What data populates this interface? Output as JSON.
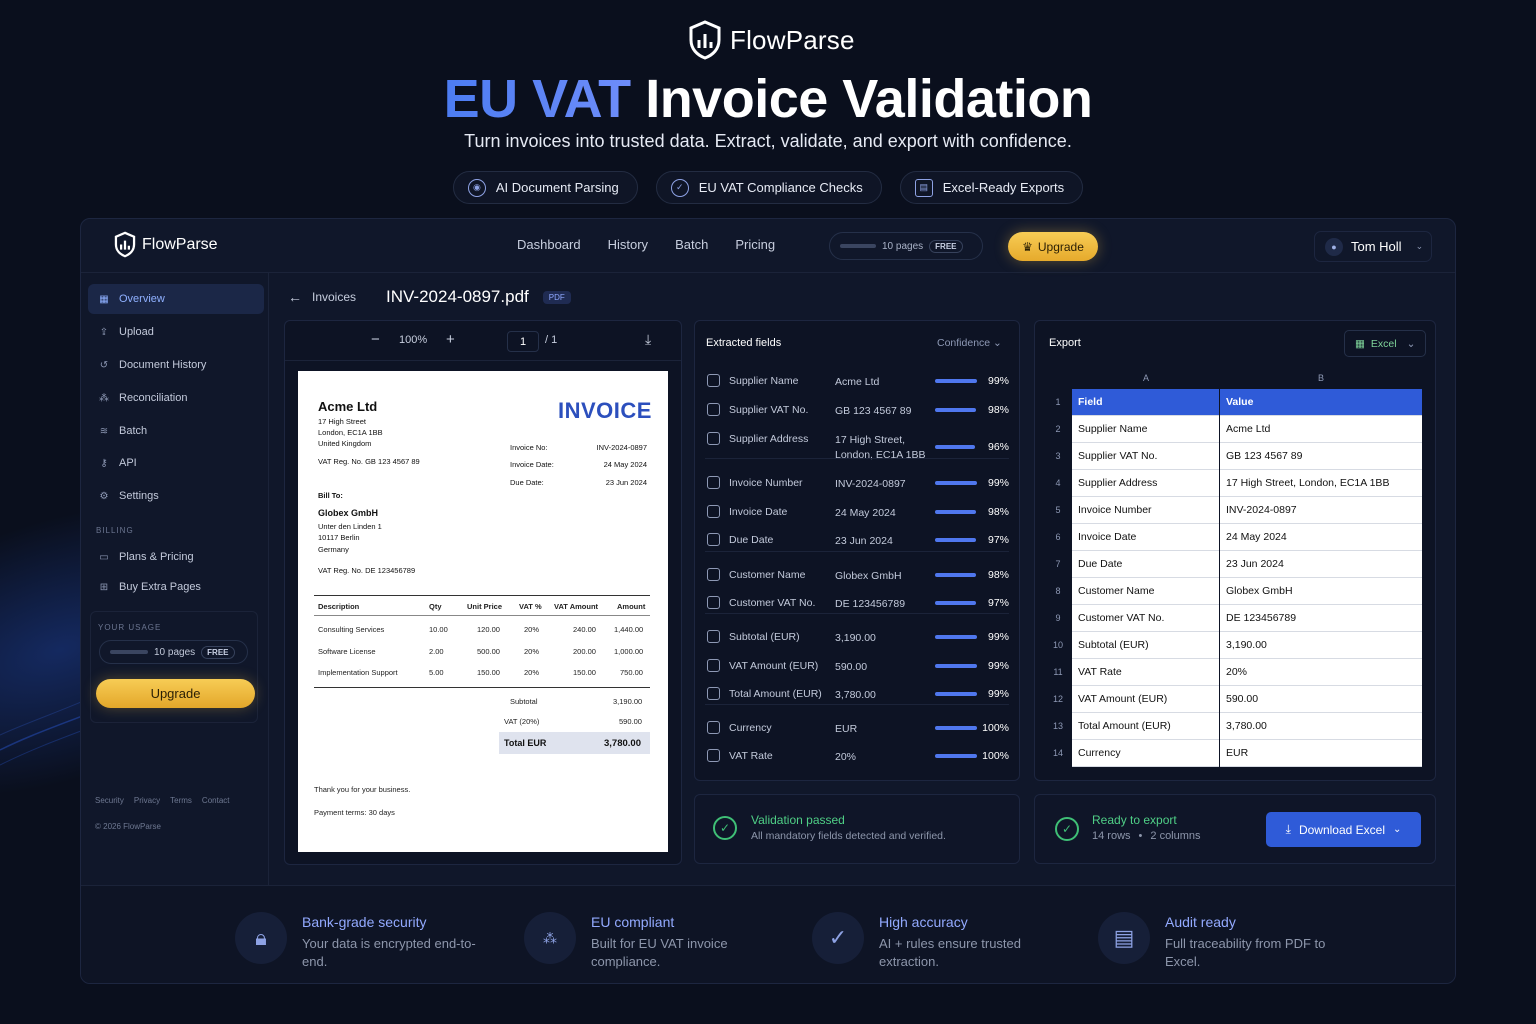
{
  "hero": {
    "brand": "FlowParse",
    "headline_accent": "EU VAT",
    "headline_rest": "Invoice Validation",
    "subtitle": "Turn invoices into trusted data. Extract, validate, and export with confidence.",
    "pills": [
      "AI Document Parsing",
      "EU VAT Compliance Checks",
      "Excel-Ready Exports"
    ]
  },
  "topbar": {
    "brand": "FlowParse",
    "nav": [
      "Dashboard",
      "History",
      "Batch",
      "Pricing"
    ],
    "usage": "10 pages",
    "free": "FREE",
    "upgrade": "Upgrade",
    "user": "Tom Holl"
  },
  "sidebar": {
    "items": [
      "Overview",
      "Upload",
      "Document History",
      "Reconciliation",
      "Batch",
      "API",
      "Settings"
    ],
    "billing_label": "BILLING",
    "billing_items": [
      "Plans & Pricing",
      "Buy Extra Pages"
    ],
    "usage_label": "YOUR USAGE",
    "usage": "10 pages",
    "free": "FREE",
    "upgrade": "Upgrade",
    "footer_links": [
      "Security",
      "Privacy",
      "Terms",
      "Contact"
    ],
    "copyright": "© 2026 FlowParse"
  },
  "breadcrumb": {
    "parent": "Invoices",
    "file": "INV-2024-0897.pdf",
    "badge": "PDF"
  },
  "viewer": {
    "zoom": "100%",
    "page": "1",
    "page_total": "/ 1",
    "invoice": {
      "seller": "Acme Ltd",
      "seller_addr": [
        "17 High Street",
        "London, EC1A 1BB",
        "United Kingdom"
      ],
      "seller_vat": "VAT Reg. No.  GB 123 4567 89",
      "title": "INVOICE",
      "meta": [
        [
          "Invoice No:",
          "INV-2024-0897"
        ],
        [
          "Invoice Date:",
          "24 May 2024"
        ],
        [
          "Due Date:",
          "23 Jun 2024"
        ]
      ],
      "bill_to_label": "Bill To:",
      "buyer": "Globex GmbH",
      "buyer_addr": [
        "Unter den Linden 1",
        "10117 Berlin",
        "Germany"
      ],
      "buyer_vat": "VAT Reg. No.   DE 123456789",
      "columns": [
        "Description",
        "Qty",
        "Unit Price",
        "VAT %",
        "VAT Amount",
        "Amount"
      ],
      "lines": [
        [
          "Consulting Services",
          "10.00",
          "120.00",
          "20%",
          "240.00",
          "1,440.00"
        ],
        [
          "Software License",
          "2.00",
          "500.00",
          "20%",
          "200.00",
          "1,000.00"
        ],
        [
          "Implementation Support",
          "5.00",
          "150.00",
          "20%",
          "150.00",
          "750.00"
        ]
      ],
      "subtotal_label": "Subtotal",
      "subtotal": "3,190.00",
      "vat_label": "VAT (20%)",
      "vat": "590.00",
      "total_label": "Total EUR",
      "total": "3,780.00",
      "thanks": "Thank you for your business.",
      "terms": "Payment terms: 30 days"
    }
  },
  "extracted": {
    "title": "Extracted fields",
    "sort": "Confidence",
    "rows": [
      {
        "label": "Supplier Name",
        "value": "Acme Ltd",
        "pct": "99%",
        "conf": 0.99
      },
      {
        "label": "Supplier VAT No.",
        "value": "GB 123 4567 89",
        "pct": "98%",
        "conf": 0.98
      },
      {
        "label": "Supplier Address",
        "value": "17 High Street,\nLondon, EC1A 1BB",
        "pct": "96%",
        "conf": 0.96
      },
      {
        "label": "Invoice Number",
        "value": "INV-2024-0897",
        "pct": "99%",
        "conf": 0.99
      },
      {
        "label": "Invoice Date",
        "value": "24 May 2024",
        "pct": "98%",
        "conf": 0.98
      },
      {
        "label": "Due Date",
        "value": "23 Jun 2024",
        "pct": "97%",
        "conf": 0.97
      },
      {
        "label": "Customer Name",
        "value": "Globex GmbH",
        "pct": "98%",
        "conf": 0.98
      },
      {
        "label": "Customer VAT No.",
        "value": "DE 123456789",
        "pct": "97%",
        "conf": 0.97
      },
      {
        "label": "Subtotal (EUR)",
        "value": "3,190.00",
        "pct": "99%",
        "conf": 0.99
      },
      {
        "label": "VAT Amount (EUR)",
        "value": "590.00",
        "pct": "99%",
        "conf": 0.99
      },
      {
        "label": "Total Amount (EUR)",
        "value": "3,780.00",
        "pct": "99%",
        "conf": 0.99
      },
      {
        "label": "Currency",
        "value": "EUR",
        "pct": "100%",
        "conf": 1.0
      },
      {
        "label": "VAT Rate",
        "value": "20%",
        "pct": "100%",
        "conf": 1.0
      }
    ]
  },
  "export": {
    "title": "Export",
    "format": "Excel",
    "col_a": "A",
    "col_b": "B",
    "rows": [
      [
        "Field",
        "Value"
      ],
      [
        "Supplier Name",
        "Acme Ltd"
      ],
      [
        "Supplier VAT No.",
        "GB 123 4567 89"
      ],
      [
        "Supplier Address",
        "17 High Street, London, EC1A 1BB"
      ],
      [
        "Invoice Number",
        "INV-2024-0897"
      ],
      [
        "Invoice Date",
        "24 May 2024"
      ],
      [
        "Due Date",
        "23 Jun 2024"
      ],
      [
        "Customer Name",
        "Globex GmbH"
      ],
      [
        "Customer VAT No.",
        "DE 123456789"
      ],
      [
        "Subtotal (EUR)",
        "3,190.00"
      ],
      [
        "VAT Rate",
        "20%"
      ],
      [
        "VAT Amount (EUR)",
        "590.00"
      ],
      [
        "Total Amount (EUR)",
        "3,780.00"
      ],
      [
        "Currency",
        "EUR"
      ]
    ]
  },
  "validation": {
    "title": "Validation passed",
    "desc": "All mandatory fields detected and verified."
  },
  "ready": {
    "title": "Ready to export",
    "rows": "14 rows",
    "dot": "•",
    "cols": "2 columns",
    "button": "Download Excel"
  },
  "features": [
    {
      "title": "Bank-grade security",
      "desc": "Your data is encrypted end-to-end."
    },
    {
      "title": "EU compliant",
      "desc": "Built for EU VAT invoice compliance."
    },
    {
      "title": "High accuracy",
      "desc": "AI + rules ensure trusted extraction."
    },
    {
      "title": "Audit ready",
      "desc": "Full traceability from PDF to Excel."
    }
  ],
  "colors": {
    "accent": "#4f77ee",
    "gold": "#f2bf45",
    "success": "#3fbf76",
    "bg": "#0a0f1d"
  }
}
